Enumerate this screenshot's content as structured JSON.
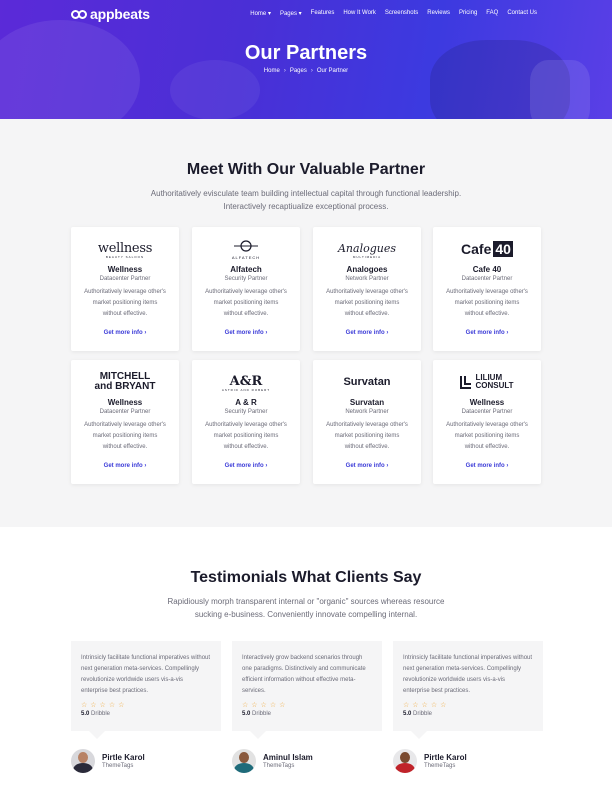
{
  "header": {
    "logo_text": "appbeats",
    "nav": [
      "Home ▾",
      "Pages ▾",
      "Features",
      "How It Work",
      "Screenshots",
      "Reviews",
      "Pricing",
      "FAQ",
      "Contact Us"
    ],
    "title": "Our Partners",
    "breadcrumb": [
      "Home",
      "Pages",
      "Our Partner"
    ],
    "breadcrumb_sep": "›"
  },
  "partners": {
    "title": "Meet With Our Valuable Partner",
    "subtitle": "Authoritatively evisculate team building intellectual capital through functional leadership. Interactively recaptiualize exceptional process.",
    "cards": [
      {
        "logo": "wellness",
        "logo_sub": "BEAUTY SALOON",
        "name": "Wellness",
        "type": "Datacenter Partner",
        "desc": "Authoritatively leverage other's market positioning items without effective.",
        "link": "Get more info ›"
      },
      {
        "logo": "ALFATECH",
        "name": "Alfatech",
        "type": "Security Partner",
        "desc": "Authoritatively leverage other's market positioning items without effective.",
        "link": "Get more info ›"
      },
      {
        "logo": "Analogues",
        "logo_sub": "MULTIMEDIA",
        "name": "Analogoes",
        "type": "Network Partner",
        "desc": "Authoritatively leverage other's market positioning items without effective.",
        "link": "Get more info ›"
      },
      {
        "logo": "Cafe",
        "logo_badge": "40",
        "name": "Cafe 40",
        "type": "Datacenter Partner",
        "desc": "Authoritatively leverage other's market positioning items without effective.",
        "link": "Get more info ›"
      },
      {
        "logo": "MITCHELL",
        "logo_line2": "and BRYANT",
        "name": "Wellness",
        "type": "Datacenter Partner",
        "desc": "Authoritatively leverage other's market positioning items without effective.",
        "link": "Get more info ›"
      },
      {
        "logo": "A&R",
        "logo_sub": "ASTRID AND ROBERT",
        "name": "A & R",
        "type": "Security Partner",
        "desc": "Authoritatively leverage other's market positioning items without effective.",
        "link": "Get more info ›"
      },
      {
        "logo": "Survatan",
        "name": "Survatan",
        "type": "Network Partner",
        "desc": "Authoritatively leverage other's market positioning items without effective.",
        "link": "Get more info ›"
      },
      {
        "logo": "LILIUM",
        "logo_line2": "CONSULT",
        "name": "Wellness",
        "type": "Datacenter Partner",
        "desc": "Authoritatively leverage other's market positioning items without effective.",
        "link": "Get more info ›"
      }
    ]
  },
  "testimonials": {
    "title": "Testimonials What Clients Say",
    "subtitle": "Rapidiously morph transparent internal or \"organic\" sources whereas resource sucking e-business. Conveniently innovate compelling internal.",
    "items": [
      {
        "text": "Intrinsicly facilitate functional imperatives without next generation meta-services. Compellingly revolutionize worldwide users vis-a-vis enterprise best practices.",
        "stars": "☆☆☆☆☆",
        "score": "5.0",
        "score_label": "Dribble",
        "name": "Pirtle Karol",
        "company": "ThemeTags",
        "colors": {
          "body": "#2a2a3a",
          "bg": "#d8d8dc"
        }
      },
      {
        "text": "Interactively grow backend scenarios through one paradigms. Distinctively and communicate efficient information without effective meta-services.",
        "stars": "☆☆☆☆☆",
        "score": "5.0",
        "score_label": "Dribble",
        "name": "Aminul Islam",
        "company": "ThemeTags",
        "colors": {
          "body": "#1f6b7a",
          "bg": "#e2e2e2"
        }
      },
      {
        "text": "Intrinsicly facilitate functional imperatives without next generation meta-services. Compellingly revolutionize worldwide users vis-a-vis enterprise best practices.",
        "stars": "☆☆☆☆☆",
        "score": "5.0",
        "score_label": "Dribble",
        "name": "Pirtle Karol",
        "company": "ThemeTags",
        "colors": {
          "body": "#c0232a",
          "bg": "#e8e8ea"
        }
      }
    ]
  }
}
